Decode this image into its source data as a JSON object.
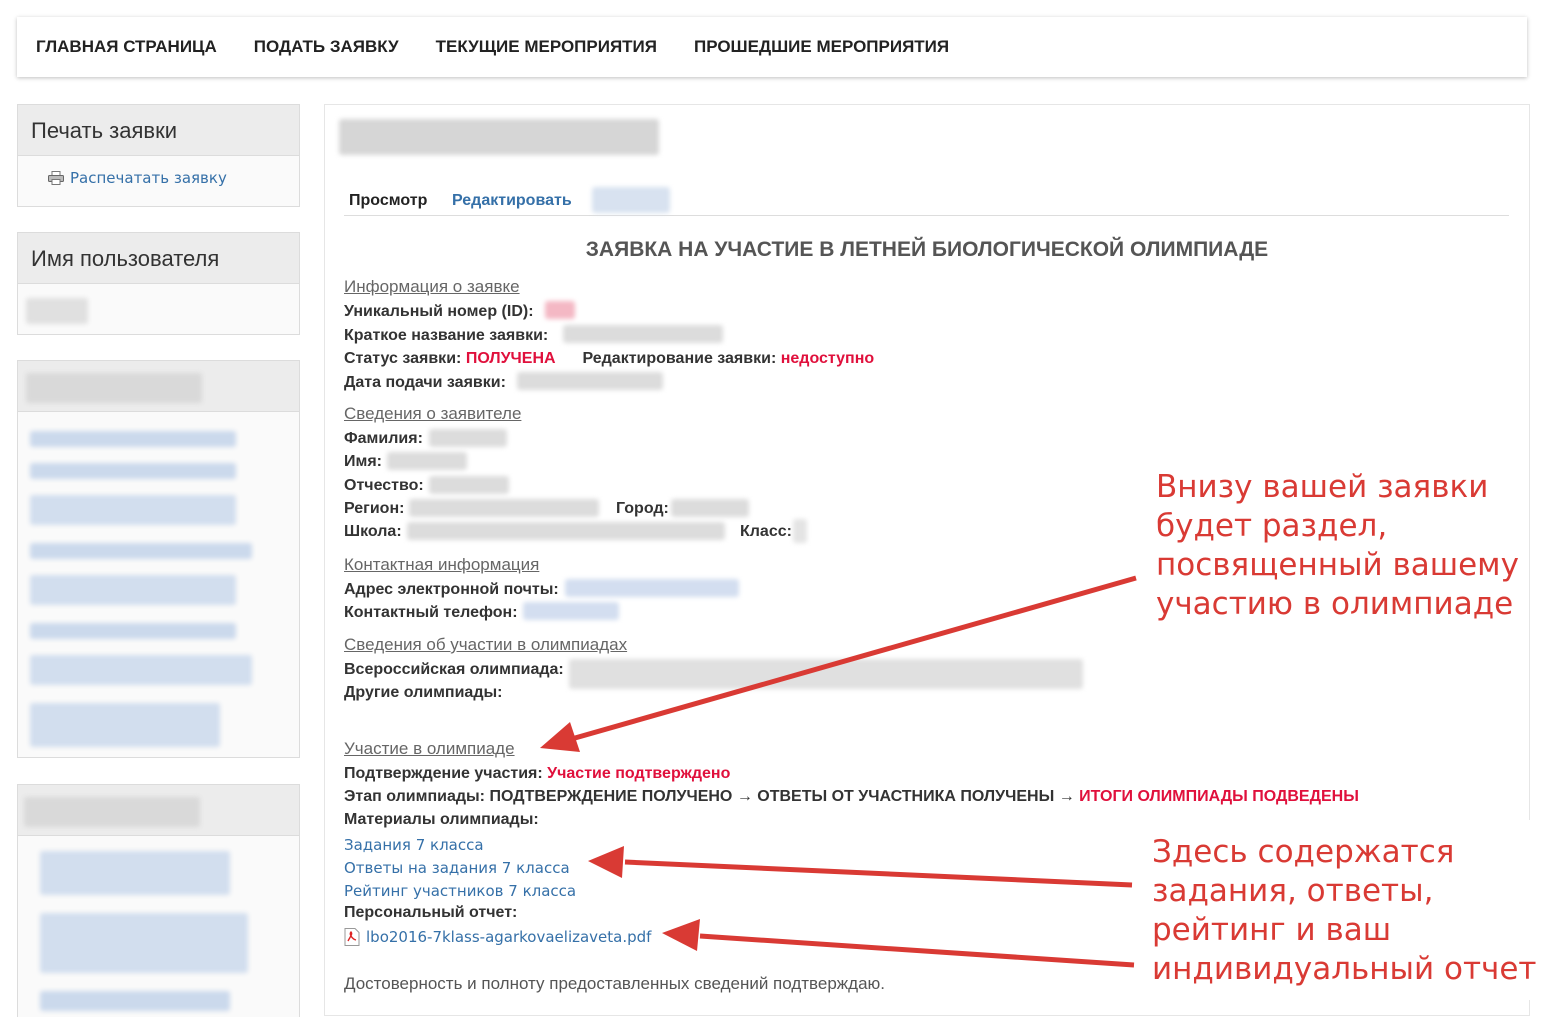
{
  "nav": {
    "items": [
      "ГЛАВНАЯ СТРАНИЦА",
      "ПОДАТЬ ЗАЯВКУ",
      "ТЕКУЩИЕ МЕРОПРИЯТИЯ",
      "ПРОШЕДШИЕ МЕРОПРИЯТИЯ"
    ]
  },
  "sidebar": {
    "print": {
      "title": "Печать заявки",
      "link": "Распечатать заявку"
    },
    "user": {
      "title": "Имя пользователя"
    }
  },
  "main": {
    "tabs": {
      "view": "Просмотр",
      "edit": "Редактировать"
    },
    "title": "ЗАЯВКА НА УЧАСТИЕ В ЛЕТНЕЙ БИОЛОГИЧЕСКОЙ ОЛИМПИАДЕ",
    "info": {
      "heading": "Информация о заявке",
      "id_label": "Уникальный номер (ID):",
      "short_name_label": "Краткое название заявки:",
      "status_label": "Статус заявки:",
      "status_value": "ПОЛУЧЕНА",
      "edit_label": "Редактирование заявки:",
      "edit_value": "недоступно",
      "date_label": "Дата подачи заявки:"
    },
    "applicant": {
      "heading": "Сведения о заявителе",
      "surname": "Фамилия:",
      "name": "Имя:",
      "patronymic": "Отчество:",
      "region": "Регион:",
      "city": "Город:",
      "school": "Школа:",
      "grade": "Класс:"
    },
    "contact": {
      "heading": "Контактная информация",
      "email": "Адрес электронной почты:",
      "phone": "Контактный телефон:"
    },
    "olympiads": {
      "heading": "Сведения об участии в олимпиадах",
      "all_russian": "Всероссийская олимпиада:",
      "other": "Другие олимпиады:"
    },
    "participation": {
      "heading": "Участие в олимпиаде",
      "confirm_label": "Подтверждение участия:",
      "confirm_value": "Участие подтверждено",
      "stage_label": "Этап олимпиады:",
      "stage_1": "ПОДТВЕРЖДЕНИЕ ПОЛУЧЕНО",
      "arrow": "→",
      "stage_2": "ОТВЕТЫ ОТ УЧАСТНИКА ПОЛУЧЕНЫ",
      "stage_3": "ИТОГИ ОЛИМПИАДЫ ПОДВЕДЕНЫ",
      "materials_label": "Материалы олимпиады:",
      "materials": [
        "Задания 7 класса",
        "Ответы на задания 7 класса",
        "Рейтинг участников 7 класса"
      ],
      "report_label": "Персональный отчет:",
      "report_file": "lbo2016-7klass-agarkovaelizaveta.pdf"
    },
    "footer_text": "Достоверность и полноту предоставленных сведений подтверждаю."
  },
  "annotations": {
    "note1": "Внизу вашей заявки\nбудет раздел,\nпосвященный вашему\nучастию в олимпиаде",
    "note2": "Здесь содержатся\nзадания, ответы,\nрейтинг и ваш\nиндивидуальный отчет"
  },
  "colors": {
    "annotation_red": "#d93a34",
    "status_red": "#e0103c",
    "link_blue": "#3570a8"
  }
}
